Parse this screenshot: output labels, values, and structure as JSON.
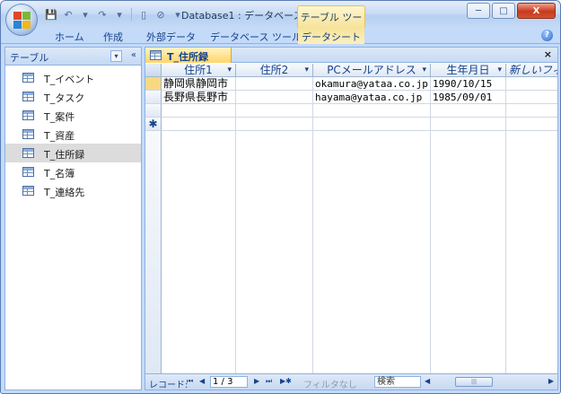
{
  "window": {
    "title": "Database1 : データベース ...",
    "context_tab_group": "テーブル ツール",
    "controls": {
      "minimize": "─",
      "maximize": "□",
      "close": "X"
    }
  },
  "qat": {
    "save": "💾",
    "undo": "↶",
    "undo_dd": "▾",
    "redo": "↷",
    "redo_dd": "▾",
    "new": "▯",
    "link": "⊘",
    "customize": "▾"
  },
  "ribbon": {
    "tabs": [
      "ホーム",
      "作成",
      "外部データ",
      "データベース ツール",
      "データシート"
    ],
    "help": "?"
  },
  "nav_pane": {
    "title": "テーブル",
    "dropdown": "▾",
    "collapse": "«",
    "items": [
      "T_イベント",
      "T_タスク",
      "T_案件",
      "T_資産",
      "T_住所録",
      "T_名簿",
      "T_連絡先"
    ],
    "selected_index": 4
  },
  "document": {
    "tab_label": "T_住所録",
    "close": "×",
    "columns": [
      "住所1",
      "住所2",
      "PCメールアドレス",
      "生年月日",
      "新しいフィ"
    ],
    "dropdown_glyph": "▾",
    "rows": [
      [
        "静岡県静岡市",
        "",
        "okamura@yataa.co.jp",
        "1990/10/15",
        ""
      ],
      [
        "長野県長野市",
        "",
        "hayama@yataa.co.jp",
        "1985/09/01",
        ""
      ]
    ],
    "new_row_marker": "✱"
  },
  "record_nav": {
    "label": "レコード:",
    "first": "⏮",
    "prev": "◀",
    "position": "1 / 3",
    "next": "▶",
    "last": "⏭",
    "new": "▶✱",
    "filter": "フィルタなし",
    "search": "検索",
    "scroll_left": "◀",
    "scroll_right": "▶",
    "scroll_thumb": "|||"
  },
  "colors": {
    "accent": "#c3daf9",
    "context_tab": "#f6e39a",
    "active_doc_tab": "#ffd56b",
    "selected_nav_item": "#dcdcdc"
  }
}
